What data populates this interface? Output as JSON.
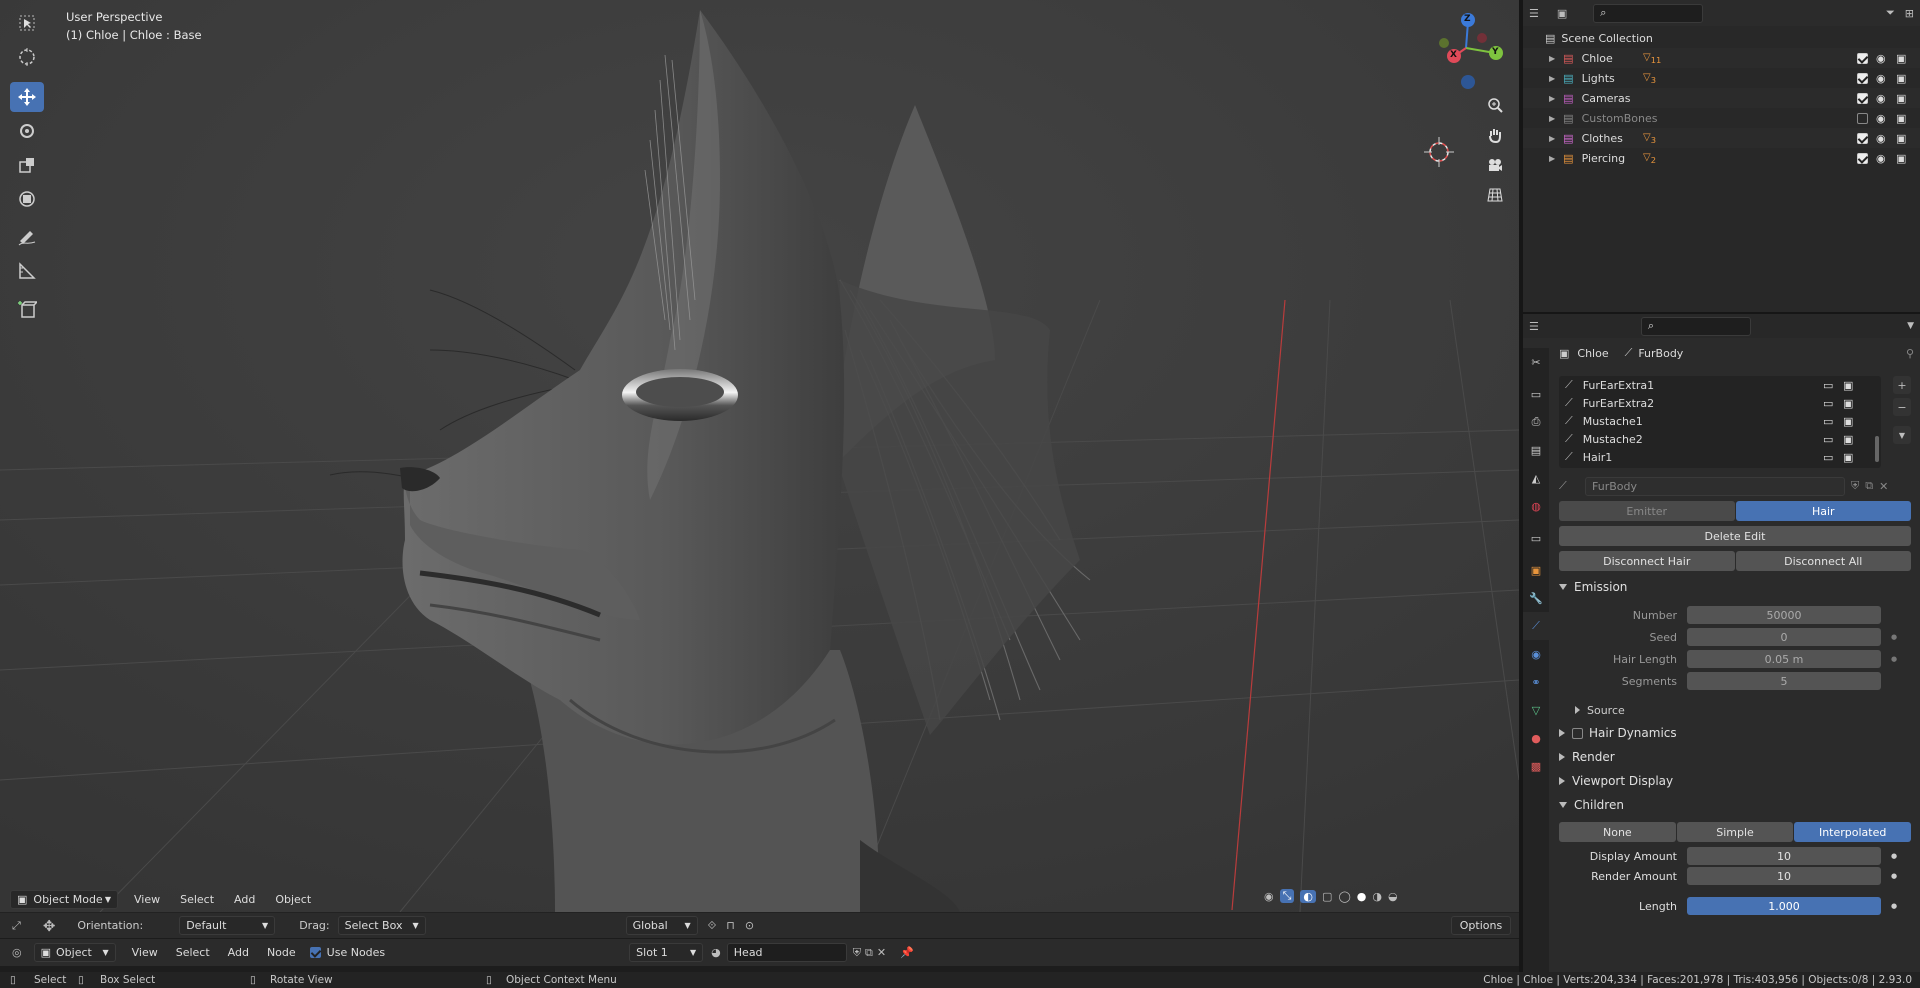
{
  "viewport": {
    "perspective": "User Perspective",
    "object_info": "(1) Chloe | Chloe : Base",
    "menu": [
      "View",
      "Select",
      "Add",
      "Object"
    ],
    "mode": "Object Mode",
    "orientation_label": "Orientation:",
    "orientation_value": "Default",
    "drag_label": "Drag:",
    "drag_value": "Select Box",
    "transform_space": "Global",
    "options": "Options",
    "gizmo": {
      "z": "Z",
      "x": "X",
      "y": "Y"
    }
  },
  "node_header": {
    "type": "Object",
    "menu": [
      "View",
      "Select",
      "Add",
      "Node"
    ],
    "use_nodes": "Use Nodes",
    "slot": "Slot 1",
    "material": "Head"
  },
  "outliner": {
    "root": "Scene Collection",
    "items": [
      {
        "name": "Chloe",
        "badge": "11",
        "enabled": true,
        "color": "#e05c5c"
      },
      {
        "name": "Lights",
        "badge": "3",
        "enabled": true,
        "color": "#4db6c6"
      },
      {
        "name": "Cameras",
        "badge": "",
        "enabled": true,
        "color": "#c460c4"
      },
      {
        "name": "CustomBones",
        "badge": "",
        "enabled": false,
        "color": "#888888"
      },
      {
        "name": "Clothes",
        "badge": "3",
        "enabled": true,
        "color": "#d36bd3"
      },
      {
        "name": "Piercing",
        "badge": "2",
        "enabled": true,
        "color": "#e8953c"
      }
    ]
  },
  "properties": {
    "breadcrumb_object": "Chloe",
    "breadcrumb_data": "FurBody",
    "particle_systems": [
      "FurEarExtra1",
      "FurEarExtra2",
      "Mustache1",
      "Mustache2",
      "Hair1"
    ],
    "settings_name": "FurBody",
    "type_emitter": "Emitter",
    "type_hair": "Hair",
    "delete_edit": "Delete Edit",
    "disconnect_hair": "Disconnect Hair",
    "disconnect_all": "Disconnect All",
    "emission": {
      "title": "Emission",
      "number_label": "Number",
      "number_value": "50000",
      "seed_label": "Seed",
      "seed_value": "0",
      "length_label": "Hair Length",
      "length_value": "0.05 m",
      "segments_label": "Segments",
      "segments_value": "5",
      "source": "Source"
    },
    "panels": [
      "Hair Dynamics",
      "Render",
      "Viewport Display"
    ],
    "children": {
      "title": "Children",
      "none": "None",
      "simple": "Simple",
      "interpolated": "Interpolated",
      "display_label": "Display Amount",
      "display_value": "10",
      "render_label": "Render Amount",
      "render_value": "10",
      "length_label": "Length",
      "length_value": "1.000"
    }
  },
  "status": {
    "select": "Select",
    "box_select": "Box Select",
    "rotate": "Rotate View",
    "context": "Object Context Menu",
    "stats": "Chloe | Chloe | Verts:204,334 | Faces:201,978 | Tris:403,956 | Objects:0/8 | 2.93.0"
  },
  "colors": {
    "accent": "#4772b3",
    "viewport_bg": "#3d3d3d",
    "panel_bg": "#2b2b2b"
  }
}
